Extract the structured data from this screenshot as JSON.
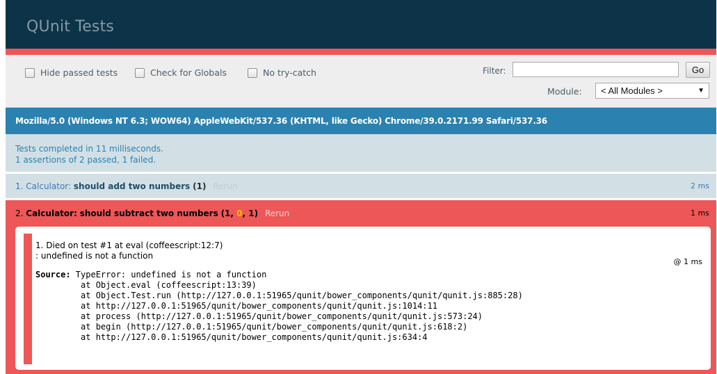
{
  "header": {
    "title": "QUnit Tests"
  },
  "toolbar": {
    "hide_passed": "Hide passed tests",
    "check_globals": "Check for Globals",
    "no_try_catch": "No try-catch",
    "filter_label": "Filter:",
    "filter_value": "",
    "go_label": "Go",
    "module_label": "Module:",
    "module_selected": "< All Modules >"
  },
  "useragent": "Mozilla/5.0 (Windows NT 6.3; WOW64) AppleWebKit/537.36 (KHTML, like Gecko) Chrome/39.0.2171.99 Safari/537.36",
  "testresult": {
    "line1": "Tests completed in 11 milliseconds.",
    "line2": "1 assertions of 2 passed, 1 failed."
  },
  "tests": [
    {
      "index": "1.",
      "module": "Calculator:",
      "name": "should add two numbers",
      "counts_open": "(",
      "counts_total": "1",
      "counts_close": ")",
      "rerun": "Rerun",
      "runtime": "2 ms"
    },
    {
      "index": "2.",
      "module": "Calculator:",
      "name": "should subtract two numbers",
      "failed": "1",
      "passed": "0",
      "total": "1",
      "rerun": "Rerun",
      "runtime": "1 ms",
      "assertion": {
        "message_line1": "1. Died on test #1  at eval (coffeescript:12:7)",
        "message_line2": ": undefined is not a function",
        "runtime": "@ 1 ms",
        "source_label": "Source:",
        "source_lines": [
          " TypeError: undefined is not a function",
          "         at Object.eval (coffeescript:13:39)",
          "         at Object.Test.run (http://127.0.0.1:51965/qunit/bower_components/qunit/qunit.js:885:28)",
          "         at http://127.0.0.1:51965/qunit/bower_components/qunit/qunit.js:1014:11",
          "         at process (http://127.0.0.1:51965/qunit/bower_components/qunit/qunit.js:573:24)",
          "         at begin (http://127.0.0.1:51965/qunit/bower_components/qunit/qunit.js:618:2)",
          "         at http://127.0.0.1:51965/qunit/bower_components/qunit/qunit.js:634:4"
        ]
      }
    }
  ],
  "colors": {
    "header_bg": "#0d3349",
    "header_title": "#8699a4",
    "fail_red": "#ee5757",
    "useragent_bg": "#2b81af",
    "result_bg": "#d2e0e6",
    "toolbar_bg": "#eeeeee"
  }
}
